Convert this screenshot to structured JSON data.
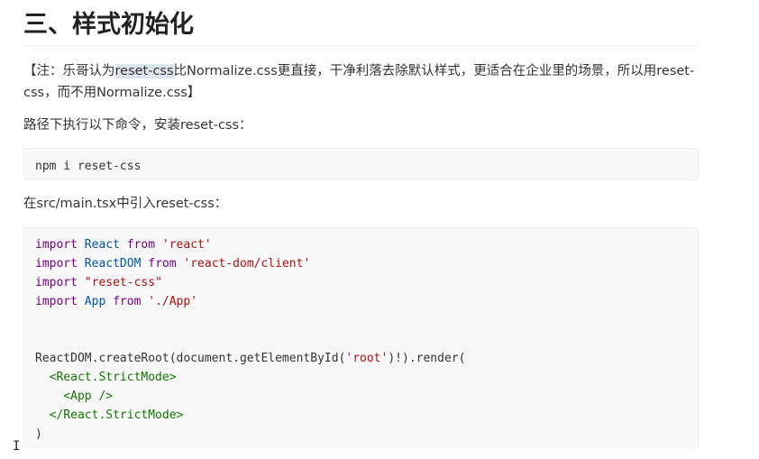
{
  "heading": "三、样式初始化",
  "note": {
    "prefix": "【注：乐哥认为",
    "highlight": "reset-css",
    "rest": "比Normalize.css更直接，干净利落去除默认样式，更适合在企业里的场景，所以用reset-css，而不用Normalize.css】"
  },
  "install_text": "路径下执行以下命令，安装reset-css：",
  "install_cmd": "npm i reset-css",
  "import_text": "在src/main.tsx中引入reset-css：",
  "code": {
    "l1": [
      "import",
      " ",
      "React",
      " ",
      "from",
      " ",
      "'react'"
    ],
    "l2": [
      "import",
      " ",
      "ReactDOM",
      " ",
      "from",
      " ",
      "'react-dom/client'"
    ],
    "l3": [
      "import",
      " ",
      "\"reset-css\""
    ],
    "l4": [
      "import",
      " ",
      "App",
      " ",
      "from",
      " ",
      "'./App'"
    ],
    "l5_a": "ReactDOM.createRoot(document.getElementById(",
    "l5_b": "'root'",
    "l5_c": ")!).render(",
    "l6": "  ",
    "l6_tag": "<React.StrictMode>",
    "l7": "    ",
    "l7_tag": "<App />",
    "l8": "  ",
    "l8_tag": "</React.StrictMode>",
    "l9": ")"
  },
  "cursor": "I"
}
